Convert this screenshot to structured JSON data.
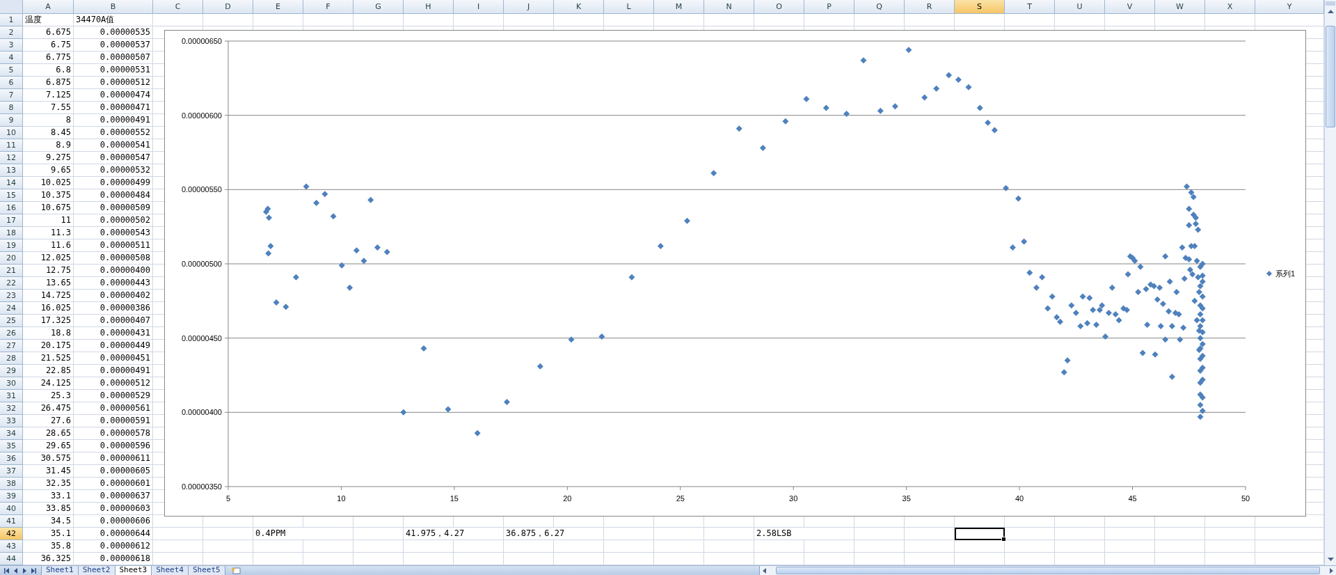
{
  "columns": [
    {
      "label": "A",
      "selected": false
    },
    {
      "label": "B",
      "selected": false
    },
    {
      "label": "C",
      "selected": false
    },
    {
      "label": "D",
      "selected": false
    },
    {
      "label": "E",
      "selected": false
    },
    {
      "label": "F",
      "selected": false
    },
    {
      "label": "G",
      "selected": false
    },
    {
      "label": "H",
      "selected": false
    },
    {
      "label": "I",
      "selected": false
    },
    {
      "label": "J",
      "selected": false
    },
    {
      "label": "K",
      "selected": false
    },
    {
      "label": "L",
      "selected": false
    },
    {
      "label": "M",
      "selected": false
    },
    {
      "label": "N",
      "selected": false
    },
    {
      "label": "O",
      "selected": false
    },
    {
      "label": "P",
      "selected": false
    },
    {
      "label": "Q",
      "selected": false
    },
    {
      "label": "R",
      "selected": false
    },
    {
      "label": "S",
      "selected": true
    },
    {
      "label": "T",
      "selected": false
    },
    {
      "label": "U",
      "selected": false
    },
    {
      "label": "V",
      "selected": false
    },
    {
      "label": "W",
      "selected": false
    },
    {
      "label": "X",
      "selected": false
    },
    {
      "label": "Y",
      "selected": false
    }
  ],
  "rows": [
    {
      "number": "1",
      "selected": false,
      "cells": [
        {
          "text": "温度",
          "kind": "text"
        },
        {
          "text": "34470A值",
          "kind": "text"
        }
      ]
    },
    {
      "number": "2",
      "selected": false,
      "cells": [
        {
          "text": "6.675",
          "kind": "number"
        },
        {
          "text": "0.00000535",
          "kind": "number"
        }
      ]
    },
    {
      "number": "3",
      "selected": false,
      "cells": [
        {
          "text": "6.75",
          "kind": "number"
        },
        {
          "text": "0.00000537",
          "kind": "number"
        }
      ]
    },
    {
      "number": "4",
      "selected": false,
      "cells": [
        {
          "text": "6.775",
          "kind": "number"
        },
        {
          "text": "0.00000507",
          "kind": "number"
        }
      ]
    },
    {
      "number": "5",
      "selected": false,
      "cells": [
        {
          "text": "6.8",
          "kind": "number"
        },
        {
          "text": "0.00000531",
          "kind": "number"
        }
      ]
    },
    {
      "number": "6",
      "selected": false,
      "cells": [
        {
          "text": "6.875",
          "kind": "number"
        },
        {
          "text": "0.00000512",
          "kind": "number"
        }
      ]
    },
    {
      "number": "7",
      "selected": false,
      "cells": [
        {
          "text": "7.125",
          "kind": "number"
        },
        {
          "text": "0.00000474",
          "kind": "number"
        }
      ]
    },
    {
      "number": "8",
      "selected": false,
      "cells": [
        {
          "text": "7.55",
          "kind": "number"
        },
        {
          "text": "0.00000471",
          "kind": "number"
        }
      ]
    },
    {
      "number": "9",
      "selected": false,
      "cells": [
        {
          "text": "8",
          "kind": "number"
        },
        {
          "text": "0.00000491",
          "kind": "number"
        }
      ]
    },
    {
      "number": "10",
      "selected": false,
      "cells": [
        {
          "text": "8.45",
          "kind": "number"
        },
        {
          "text": "0.00000552",
          "kind": "number"
        }
      ]
    },
    {
      "number": "11",
      "selected": false,
      "cells": [
        {
          "text": "8.9",
          "kind": "number"
        },
        {
          "text": "0.00000541",
          "kind": "number"
        }
      ]
    },
    {
      "number": "12",
      "selected": false,
      "cells": [
        {
          "text": "9.275",
          "kind": "number"
        },
        {
          "text": "0.00000547",
          "kind": "number"
        }
      ]
    },
    {
      "number": "13",
      "selected": false,
      "cells": [
        {
          "text": "9.65",
          "kind": "number"
        },
        {
          "text": "0.00000532",
          "kind": "number"
        }
      ]
    },
    {
      "number": "14",
      "selected": false,
      "cells": [
        {
          "text": "10.025",
          "kind": "number"
        },
        {
          "text": "0.00000499",
          "kind": "number"
        }
      ]
    },
    {
      "number": "15",
      "selected": false,
      "cells": [
        {
          "text": "10.375",
          "kind": "number"
        },
        {
          "text": "0.00000484",
          "kind": "number"
        }
      ]
    },
    {
      "number": "16",
      "selected": false,
      "cells": [
        {
          "text": "10.675",
          "kind": "number"
        },
        {
          "text": "0.00000509",
          "kind": "number"
        }
      ]
    },
    {
      "number": "17",
      "selected": false,
      "cells": [
        {
          "text": "11",
          "kind": "number"
        },
        {
          "text": "0.00000502",
          "kind": "number"
        }
      ]
    },
    {
      "number": "18",
      "selected": false,
      "cells": [
        {
          "text": "11.3",
          "kind": "number"
        },
        {
          "text": "0.00000543",
          "kind": "number"
        }
      ]
    },
    {
      "number": "19",
      "selected": false,
      "cells": [
        {
          "text": "11.6",
          "kind": "number"
        },
        {
          "text": "0.00000511",
          "kind": "number"
        }
      ]
    },
    {
      "number": "20",
      "selected": false,
      "cells": [
        {
          "text": "12.025",
          "kind": "number"
        },
        {
          "text": "0.00000508",
          "kind": "number"
        }
      ]
    },
    {
      "number": "21",
      "selected": false,
      "cells": [
        {
          "text": "12.75",
          "kind": "number"
        },
        {
          "text": "0.00000400",
          "kind": "number"
        }
      ]
    },
    {
      "number": "22",
      "selected": false,
      "cells": [
        {
          "text": "13.65",
          "kind": "number"
        },
        {
          "text": "0.00000443",
          "kind": "number"
        }
      ]
    },
    {
      "number": "23",
      "selected": false,
      "cells": [
        {
          "text": "14.725",
          "kind": "number"
        },
        {
          "text": "0.00000402",
          "kind": "number"
        }
      ]
    },
    {
      "number": "24",
      "selected": false,
      "cells": [
        {
          "text": "16.025",
          "kind": "number"
        },
        {
          "text": "0.00000386",
          "kind": "number"
        }
      ]
    },
    {
      "number": "25",
      "selected": false,
      "cells": [
        {
          "text": "17.325",
          "kind": "number"
        },
        {
          "text": "0.00000407",
          "kind": "number"
        }
      ]
    },
    {
      "number": "26",
      "selected": false,
      "cells": [
        {
          "text": "18.8",
          "kind": "number"
        },
        {
          "text": "0.00000431",
          "kind": "number"
        }
      ]
    },
    {
      "number": "27",
      "selected": false,
      "cells": [
        {
          "text": "20.175",
          "kind": "number"
        },
        {
          "text": "0.00000449",
          "kind": "number"
        }
      ]
    },
    {
      "number": "28",
      "selected": false,
      "cells": [
        {
          "text": "21.525",
          "kind": "number"
        },
        {
          "text": "0.00000451",
          "kind": "number"
        }
      ]
    },
    {
      "number": "29",
      "selected": false,
      "cells": [
        {
          "text": "22.85",
          "kind": "number"
        },
        {
          "text": "0.00000491",
          "kind": "number"
        }
      ]
    },
    {
      "number": "30",
      "selected": false,
      "cells": [
        {
          "text": "24.125",
          "kind": "number"
        },
        {
          "text": "0.00000512",
          "kind": "number"
        }
      ]
    },
    {
      "number": "31",
      "selected": false,
      "cells": [
        {
          "text": "25.3",
          "kind": "number"
        },
        {
          "text": "0.00000529",
          "kind": "number"
        }
      ]
    },
    {
      "number": "32",
      "selected": false,
      "cells": [
        {
          "text": "26.475",
          "kind": "number"
        },
        {
          "text": "0.00000561",
          "kind": "number"
        }
      ]
    },
    {
      "number": "33",
      "selected": false,
      "cells": [
        {
          "text": "27.6",
          "kind": "number"
        },
        {
          "text": "0.00000591",
          "kind": "number"
        }
      ]
    },
    {
      "number": "34",
      "selected": false,
      "cells": [
        {
          "text": "28.65",
          "kind": "number"
        },
        {
          "text": "0.00000578",
          "kind": "number"
        }
      ]
    },
    {
      "number": "35",
      "selected": false,
      "cells": [
        {
          "text": "29.65",
          "kind": "number"
        },
        {
          "text": "0.00000596",
          "kind": "number"
        }
      ]
    },
    {
      "number": "36",
      "selected": false,
      "cells": [
        {
          "text": "30.575",
          "kind": "number"
        },
        {
          "text": "0.00000611",
          "kind": "number"
        }
      ]
    },
    {
      "number": "37",
      "selected": false,
      "cells": [
        {
          "text": "31.45",
          "kind": "number"
        },
        {
          "text": "0.00000605",
          "kind": "number"
        }
      ]
    },
    {
      "number": "38",
      "selected": false,
      "cells": [
        {
          "text": "32.35",
          "kind": "number"
        },
        {
          "text": "0.00000601",
          "kind": "number"
        }
      ]
    },
    {
      "number": "39",
      "selected": false,
      "cells": [
        {
          "text": "33.1",
          "kind": "number"
        },
        {
          "text": "0.00000637",
          "kind": "number"
        }
      ]
    },
    {
      "number": "40",
      "selected": false,
      "cells": [
        {
          "text": "33.85",
          "kind": "number"
        },
        {
          "text": "0.00000603",
          "kind": "number"
        }
      ]
    },
    {
      "number": "41",
      "selected": false,
      "cells": [
        {
          "text": "34.5",
          "kind": "number"
        },
        {
          "text": "0.00000606",
          "kind": "number"
        }
      ]
    },
    {
      "number": "42",
      "selected": true,
      "cells": [
        {
          "text": "35.1",
          "kind": "number"
        },
        {
          "text": "0.00000644",
          "kind": "number"
        },
        null,
        null,
        {
          "text": "0.4PPM",
          "kind": "text"
        },
        null,
        null,
        {
          "text": "41.975，4.27",
          "kind": "text"
        },
        null,
        {
          "text": "36.875，6.27",
          "kind": "text"
        },
        null,
        null,
        null,
        null,
        {
          "text": "2.58LSB",
          "kind": "text"
        }
      ]
    },
    {
      "number": "43",
      "selected": false,
      "cells": [
        {
          "text": "35.8",
          "kind": "number"
        },
        {
          "text": "0.00000612",
          "kind": "number"
        }
      ]
    },
    {
      "number": "44",
      "selected": false,
      "cells": [
        {
          "text": "36.325",
          "kind": "number"
        },
        {
          "text": "0.00000618",
          "kind": "number"
        }
      ]
    }
  ],
  "chart_data": {
    "type": "scatter",
    "grid": true,
    "xlim": [
      5,
      50
    ],
    "ylim": [
      3.5e-06,
      6.5e-06
    ],
    "xticks": [
      5,
      10,
      15,
      20,
      25,
      30,
      35,
      40,
      45,
      50
    ],
    "yticks": [
      {
        "value": 3.5e-06,
        "label": "0.00000350"
      },
      {
        "value": 4e-06,
        "label": "0.00000400"
      },
      {
        "value": 4.5e-06,
        "label": "0.00000450"
      },
      {
        "value": 5e-06,
        "label": "0.00000500"
      },
      {
        "value": 5.5e-06,
        "label": "0.00000550"
      },
      {
        "value": 6e-06,
        "label": "0.00000600"
      },
      {
        "value": 6.5e-06,
        "label": "0.00000650"
      }
    ],
    "x": [
      6.675,
      6.75,
      6.775,
      6.8,
      6.875,
      7.125,
      7.55,
      8,
      8.45,
      8.9,
      9.275,
      9.65,
      10.025,
      10.375,
      10.675,
      11,
      11.3,
      11.6,
      12.025,
      12.75,
      13.65,
      14.725,
      16.025,
      17.325,
      18.8,
      20.175,
      21.525,
      22.85,
      24.125,
      25.3,
      26.475,
      27.6,
      28.65,
      29.65,
      30.575,
      31.45,
      32.35,
      33.1,
      33.85,
      34.5,
      35.1,
      35.8,
      36.325,
      36.875,
      37.3,
      37.75,
      38.25,
      38.6,
      38.9,
      39.4,
      39.7,
      39.95,
      40.2,
      40.45,
      40.75,
      41,
      41.25,
      41.45,
      41.65,
      41.8,
      41.975,
      42.125,
      42.3,
      42.5,
      42.7,
      42.8,
      43,
      43.1,
      43.25,
      43.4,
      43.55,
      43.65,
      43.8,
      43.95,
      44.1,
      44.25,
      44.4,
      44.6,
      44.75,
      44.8,
      44.9,
      45,
      45.1,
      45.25,
      45.35,
      45.45,
      45.6,
      45.65,
      45.8,
      45.95,
      46,
      46.1,
      46.2,
      46.25,
      46.35,
      46.45,
      46.45,
      46.6,
      46.65,
      46.75,
      46.75,
      46.9,
      46.95,
      47.05,
      47.1,
      47.2,
      47.25,
      47.3,
      47.35,
      47.4,
      47.5,
      47.5,
      47.5,
      47.55,
      47.6,
      47.6,
      47.65,
      47.7,
      47.7,
      47.75,
      47.75,
      47.8,
      47.8,
      47.85,
      47.85,
      47.9,
      47.9,
      47.95,
      47.95,
      47.95,
      48,
      48,
      48,
      48,
      48,
      48,
      48,
      48,
      48,
      48,
      48,
      48,
      48,
      48.1,
      48.1,
      48.1,
      48.1,
      48.1,
      48.1,
      48.1,
      48.1,
      48.1,
      48.1,
      48.1,
      48.1,
      48.1
    ],
    "series": [
      {
        "name": "系列1",
        "color": "#4f81bd",
        "values": [
          5.35e-06,
          5.37e-06,
          5.07e-06,
          5.31e-06,
          5.12e-06,
          4.74e-06,
          4.71e-06,
          4.91e-06,
          5.52e-06,
          5.41e-06,
          5.47e-06,
          5.32e-06,
          4.99e-06,
          4.84e-06,
          5.09e-06,
          5.02e-06,
          5.43e-06,
          5.11e-06,
          5.08e-06,
          4e-06,
          4.43e-06,
          4.02e-06,
          3.86e-06,
          4.07e-06,
          4.31e-06,
          4.49e-06,
          4.51e-06,
          4.91e-06,
          5.12e-06,
          5.29e-06,
          5.61e-06,
          5.91e-06,
          5.78e-06,
          5.96e-06,
          6.11e-06,
          6.05e-06,
          6.01e-06,
          6.37e-06,
          6.03e-06,
          6.06e-06,
          6.44e-06,
          6.12e-06,
          6.18e-06,
          6.27e-06,
          6.24e-06,
          6.19e-06,
          6.05e-06,
          5.95e-06,
          5.9e-06,
          5.51e-06,
          5.11e-06,
          5.44e-06,
          5.15e-06,
          4.94e-06,
          4.84e-06,
          4.91e-06,
          4.7e-06,
          4.78e-06,
          4.64e-06,
          4.61e-06,
          4.27e-06,
          4.35e-06,
          4.72e-06,
          4.67e-06,
          4.58e-06,
          4.78e-06,
          4.6e-06,
          4.77e-06,
          4.69e-06,
          4.59e-06,
          4.69e-06,
          4.72e-06,
          4.51e-06,
          4.67e-06,
          4.84e-06,
          4.66e-06,
          4.62e-06,
          4.7e-06,
          4.69e-06,
          4.93e-06,
          5.05e-06,
          5.04e-06,
          5.02e-06,
          4.81e-06,
          4.98e-06,
          4.4e-06,
          4.83e-06,
          4.59e-06,
          4.86e-06,
          4.85e-06,
          4.39e-06,
          4.76e-06,
          4.84e-06,
          4.58e-06,
          4.73e-06,
          4.49e-06,
          5.05e-06,
          4.68e-06,
          4.88e-06,
          4.58e-06,
          4.24e-06,
          4.67e-06,
          4.81e-06,
          4.66e-06,
          4.49e-06,
          5.11e-06,
          4.57e-06,
          4.9e-06,
          5.04e-06,
          5.52e-06,
          5.37e-06,
          5.26e-06,
          5.03e-06,
          4.96e-06,
          5.48e-06,
          5.12e-06,
          4.93e-06,
          5.45e-06,
          5.33e-06,
          5.12e-06,
          4.75e-06,
          5.31e-06,
          5.27e-06,
          5.02e-06,
          4.62e-06,
          5.23e-06,
          4.91e-06,
          4.81e-06,
          4.55e-06,
          4.42e-06,
          4.98e-06,
          4.85e-06,
          4.72e-06,
          4.66e-06,
          4.58e-06,
          4.5e-06,
          4.43e-06,
          4.36e-06,
          4.28e-06,
          4.2e-06,
          4.12e-06,
          4.05e-06,
          3.97e-06,
          5e-06,
          4.92e-06,
          4.88e-06,
          4.78e-06,
          4.7e-06,
          4.62e-06,
          4.54e-06,
          4.46e-06,
          4.38e-06,
          4.3e-06,
          4.22e-06,
          4.1e-06,
          4.01e-06
        ]
      }
    ]
  },
  "sheets": [
    {
      "label": "Sheet1",
      "selected": false
    },
    {
      "label": "Sheet2",
      "selected": false
    },
    {
      "label": "Sheet3",
      "selected": true
    },
    {
      "label": "Sheet4",
      "selected": false
    },
    {
      "label": "Sheet5",
      "selected": false
    }
  ]
}
